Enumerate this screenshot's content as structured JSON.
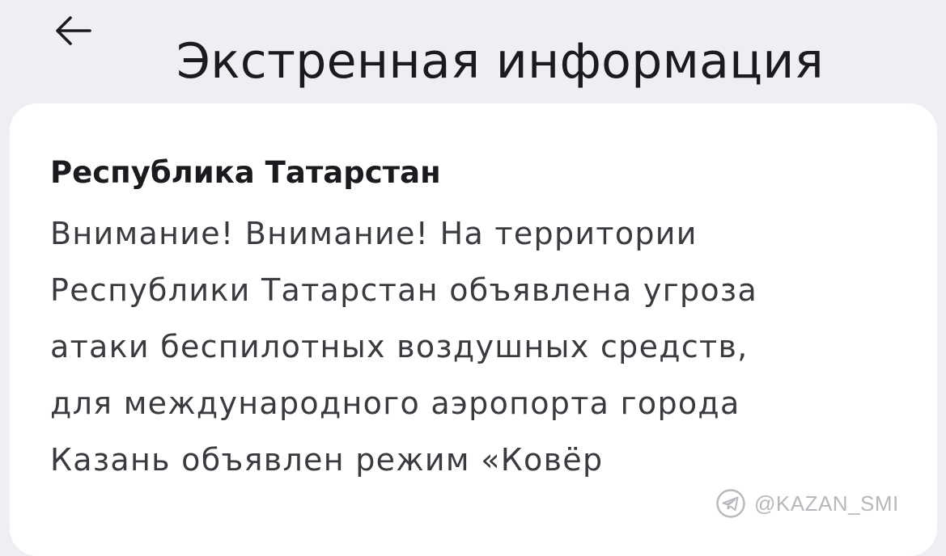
{
  "header": {
    "back_icon": "arrow-left-icon",
    "title": "Экстренная информация"
  },
  "alert": {
    "region": "Республика Татарстан",
    "body_lines": [
      "Внимание! Внимание! На территории",
      "Республики Татарстан объявлена угроза",
      "атаки беспилотных воздушных средств,",
      "для международного аэропорта города",
      "Казань объявлен режим «Ковёр"
    ]
  },
  "watermark": {
    "icon": "telegram-icon",
    "handle": "@KAZAN_SMI"
  },
  "colors": {
    "background": "#eeeff3",
    "card": "#ffffff",
    "title_text": "#1b1b1f",
    "body_text": "#3a3a40",
    "watermark": "#b4b4ba"
  }
}
